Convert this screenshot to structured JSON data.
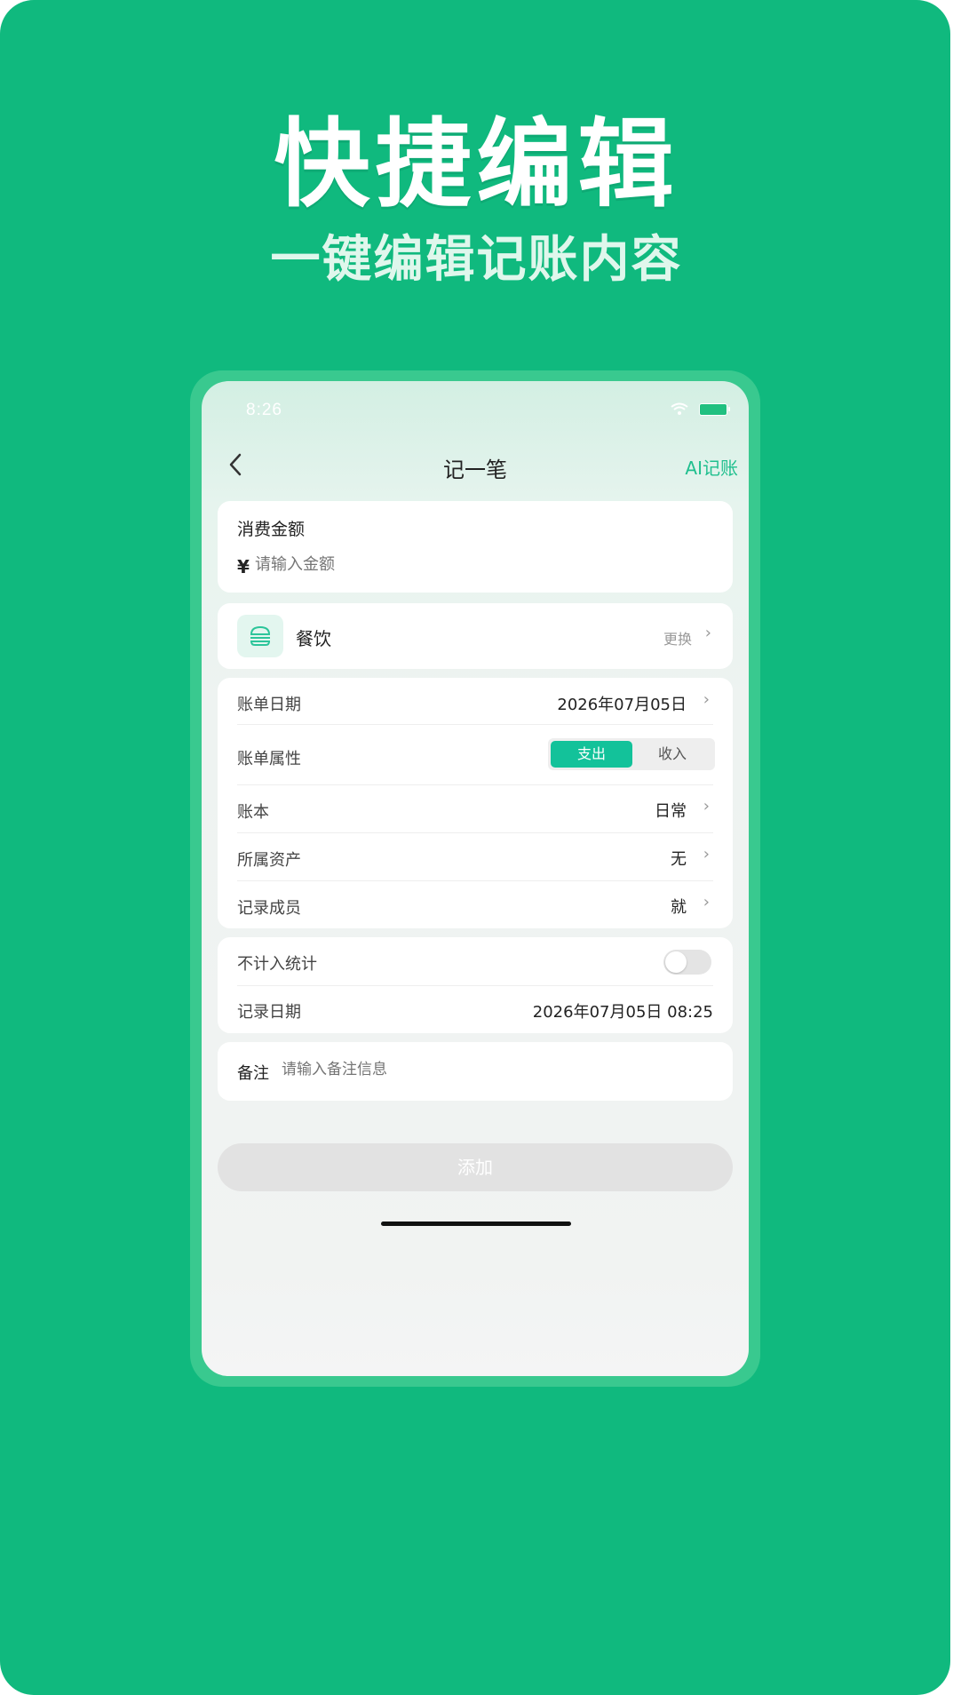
{
  "headline": {
    "title": "快捷编辑",
    "subtitle": "一键编辑记账内容"
  },
  "status_bar": {
    "time": "8:26"
  },
  "nav": {
    "back_icon": "chevron-left-icon",
    "title": "记一笔",
    "ai_label": "AI记账"
  },
  "amount": {
    "label": "消费金额",
    "currency": "¥",
    "placeholder": "请输入金额"
  },
  "category": {
    "icon": "burger-icon",
    "name": "餐饮",
    "change_label": "更换"
  },
  "bill": {
    "date_label": "账单日期",
    "date_value": "2026年07月05日",
    "type_label": "账单属性",
    "type_options": [
      "支出",
      "收入"
    ],
    "type_selected": "支出",
    "book_label": "账本",
    "book_value": "日常",
    "asset_label": "所属资产",
    "asset_value": "无",
    "member_label": "记录成员",
    "member_value": "就"
  },
  "stats": {
    "exclude_label": "不计入统计",
    "exclude_on": false,
    "record_date_label": "记录日期",
    "record_date_value": "2026年07月05日 08:25"
  },
  "note": {
    "label": "备注",
    "placeholder": "请输入备注信息"
  },
  "actions": {
    "add_label": "添加"
  },
  "colors": {
    "poster_bg": "#10b97e",
    "phone_frame": "#39c98f",
    "accent": "#13c29a",
    "ai_text": "#1fbf8e"
  }
}
